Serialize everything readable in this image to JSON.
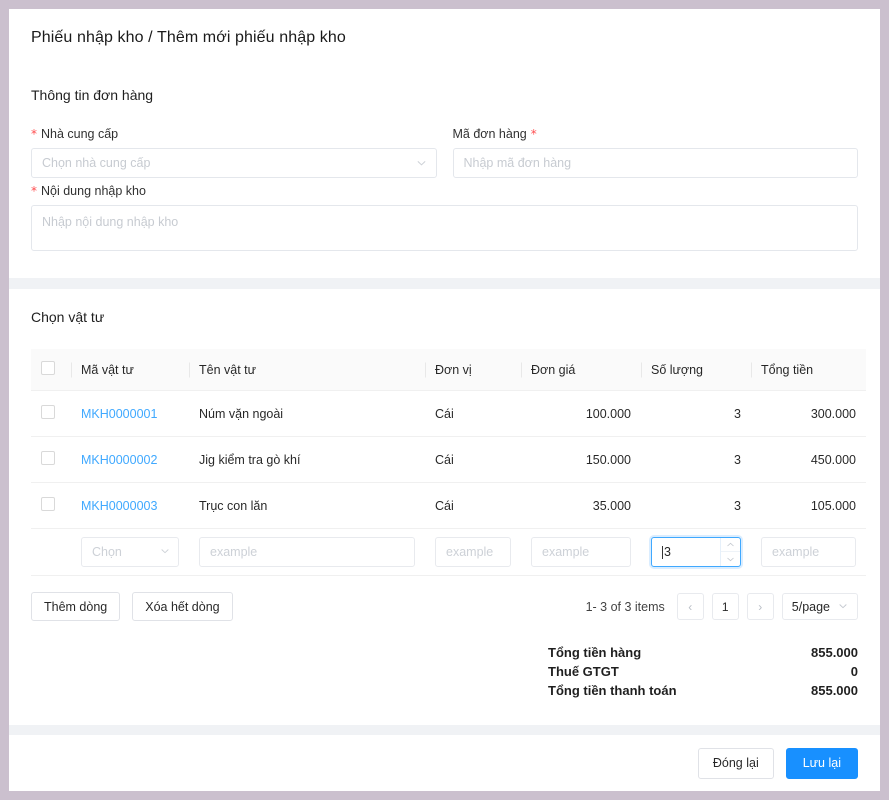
{
  "header": {
    "title": "Phiếu nhập kho / Thêm mới phiếu nhập kho"
  },
  "order_info": {
    "section_title": "Thông tin đơn hàng",
    "supplier": {
      "label": "Nhà cung cấp",
      "required_marker": "*",
      "placeholder": "Chọn nhà cung cấp",
      "value": "",
      "icon": "chevron-down-icon"
    },
    "order_code": {
      "label": "Mã đơn hàng",
      "required_marker": "*",
      "placeholder": "Nhập mã đơn hàng",
      "value": ""
    },
    "content": {
      "label": "Nội dung nhập kho",
      "required_marker": "*",
      "placeholder": "Nhập nội dung nhập kho",
      "value": ""
    }
  },
  "materials": {
    "section_title": "Chọn vật tư",
    "columns": [
      {
        "key": "check",
        "label": ""
      },
      {
        "key": "code",
        "label": "Mã vật tư"
      },
      {
        "key": "name",
        "label": "Tên vật tư"
      },
      {
        "key": "unit",
        "label": "Đơn vị"
      },
      {
        "key": "price",
        "label": "Đơn giá"
      },
      {
        "key": "qty",
        "label": "Số lượng"
      },
      {
        "key": "total",
        "label": "Tổng tiền"
      }
    ],
    "rows": [
      {
        "code": "MKH0000001",
        "name": "Núm vặn ngoài",
        "unit": "Cái",
        "price": "100.000",
        "qty": "3",
        "total": "300.000"
      },
      {
        "code": "MKH0000002",
        "name": "Jig kiểm tra gò khí",
        "unit": "Cái",
        "price": "150.000",
        "qty": "3",
        "total": "450.000"
      },
      {
        "code": "MKH0000003",
        "name": "Trục con lăn",
        "unit": "Cái",
        "price": "35.000",
        "qty": "3",
        "total": "105.000"
      }
    ],
    "new_row": {
      "code_select_placeholder": "Chọn",
      "name_placeholder": "example",
      "unit_placeholder": "example",
      "price_placeholder": "example",
      "qty_value": "3",
      "qty_focused": true,
      "col6_placeholder": "example",
      "col7_placeholder": "example"
    },
    "actions": {
      "add_row": "Thêm dòng",
      "clear_rows": "Xóa hết dòng"
    },
    "pagination": {
      "info": "1- 3 of 3 items",
      "prev": "‹",
      "next": "›",
      "current_page": "1",
      "page_size": "5/page"
    },
    "totals": [
      {
        "label": "Tổng tiền hàng",
        "value": "855.000"
      },
      {
        "label": "Thuế GTGT",
        "value": "0"
      },
      {
        "label": "Tổng tiền thanh toán",
        "value": "855.000"
      }
    ]
  },
  "footer": {
    "close_label": "Đóng lại",
    "save_label": "Lưu lại"
  },
  "colors": {
    "frame": "#cbc0ce",
    "body_bg": "#f0f2f5",
    "primary": "#1890ff",
    "link": "#40a9ff",
    "required": "#ff4d4f",
    "focus_border": "#40a9ff"
  }
}
